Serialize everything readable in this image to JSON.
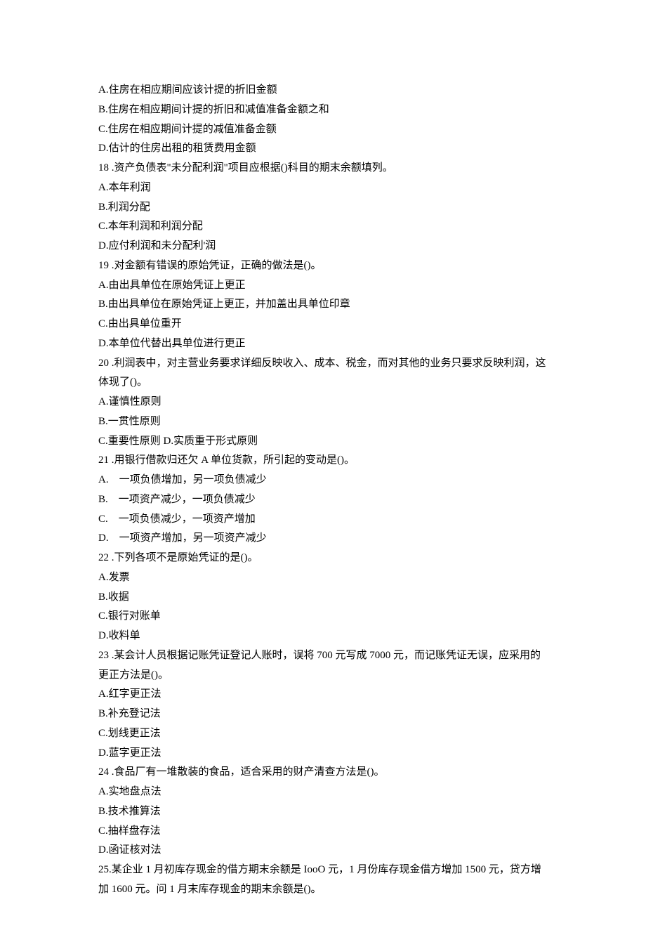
{
  "lines": [
    "A.住房在相应期间应该计提的折旧金额",
    "B.住房在相应期间计提的折旧和减值准备金额之和",
    "C.住房在相应期间计提的减值准备金额",
    "D.估计的住房出租的租赁费用金额",
    "18 .资产负债表\"未分配利润\"项目应根据()科目的期末余额填列。",
    "A.本年利润",
    "B.利润分配",
    "C.本年利润和利润分配",
    "D.应付利润和未分配利'润",
    "19 .对金额有错误的原始凭证，正确的做法是()。",
    "A.由出具单位在原始凭证上更正",
    "B.由出具单位在原始凭证上更正，并加盖出具单位印章",
    "C.由出具单位重开",
    "D.本单位代替出具单位进行更正",
    "20 .利润表中，对主营业务要求详细反映收入、成本、税金，而对其他的业务只要求反映利润，这体现了()。",
    "A.谨慎性原则",
    "B.一贯性原则",
    "C.重要性原则 D.实质重于形式原则",
    "21 .用银行借款归还欠 A 单位货款，所引起的变动是()。",
    "A.　一项负债增加，另一项负债减少",
    "B.　一项资产减少，一项负债减少",
    "C.　一项负债减少，一项资产增加",
    "D.　一项资产增加，另一项资产减少",
    "22 .下列各项不是原始凭证的是()。",
    "A.发票",
    "B.收据",
    "C.银行对账单",
    "D.收料单",
    "23 .某会计人员根据记账凭证登记人账时，误将 700 元写成 7000 元，而记账凭证无误，应采用的更正方法是()。",
    "A.红字更正法",
    "B.补充登记法",
    "C.划线更正法",
    "D.蓝字更正法",
    "24 .食品厂有一堆散装的食品，适合采用的财产清查方法是()。",
    "A.实地盘点法",
    "B.技术推算法",
    "C.抽样盘存法",
    "D.函证核对法",
    "25.某企业 1 月初库存现金的借方期末余额是 IooO 元，1 月份库存现金借方增加 1500 元，贷方增加 1600 元。问 1 月末库存现金的期末余额是()。"
  ]
}
